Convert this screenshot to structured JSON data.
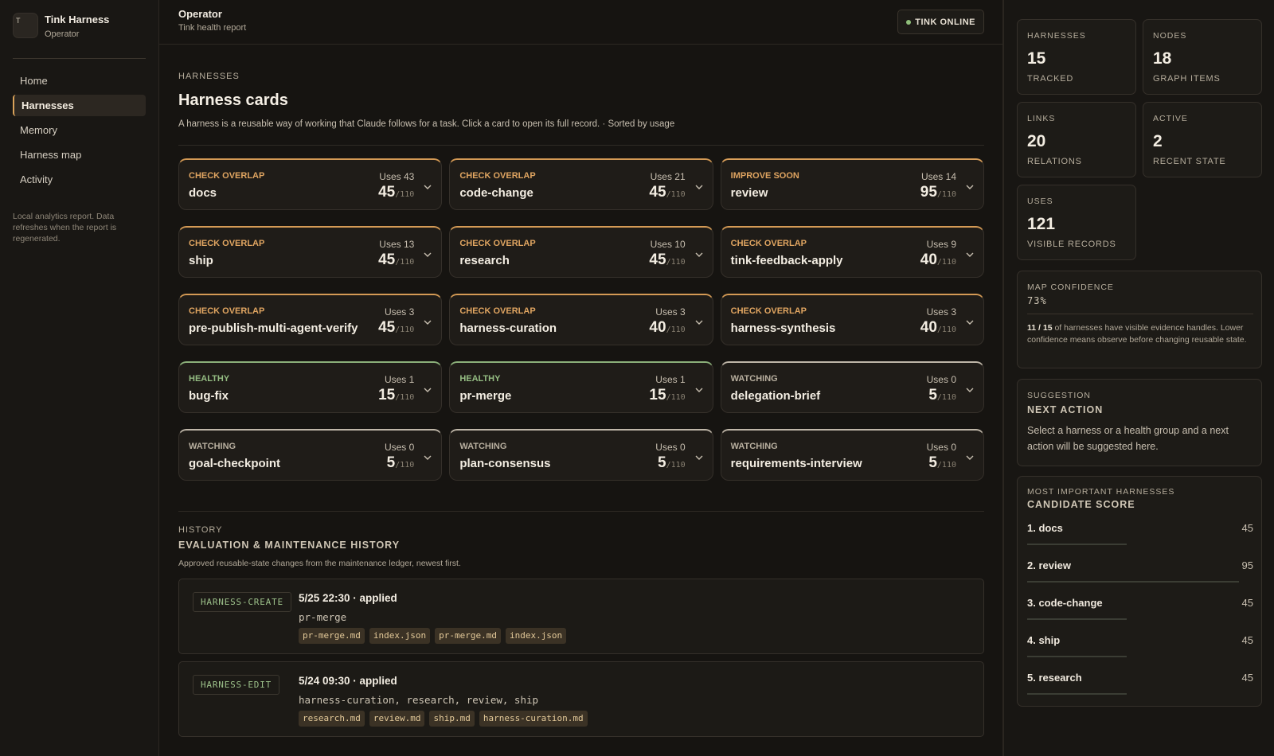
{
  "brand": {
    "logo_letter": "T",
    "title": "Tink Harness",
    "subtitle": "Operator"
  },
  "nav": [
    {
      "label": "Home",
      "active": false
    },
    {
      "label": "Harnesses",
      "active": true
    },
    {
      "label": "Memory",
      "active": false
    },
    {
      "label": "Harness map",
      "active": false
    },
    {
      "label": "Activity",
      "active": false
    }
  ],
  "sidebar_note": "Local analytics report. Data refreshes when the report is regenerated.",
  "topbar": {
    "title": "Operator",
    "subtitle": "Tink health report",
    "status": "TINK ONLINE"
  },
  "section": {
    "eyebrow": "HARNESSES",
    "title": "Harness cards",
    "description": "A harness is a reusable way of working that Claude follows for a task. Click a card to open its full record. · Sorted by usage"
  },
  "cards": [
    {
      "status": "CHECK OVERLAP",
      "kind": "check",
      "name": "docs",
      "uses": "Uses 43",
      "score": "45",
      "max": "/110"
    },
    {
      "status": "CHECK OVERLAP",
      "kind": "check",
      "name": "code-change",
      "uses": "Uses 21",
      "score": "45",
      "max": "/110"
    },
    {
      "status": "IMPROVE SOON",
      "kind": "improve",
      "name": "review",
      "uses": "Uses 14",
      "score": "95",
      "max": "/110"
    },
    {
      "status": "CHECK OVERLAP",
      "kind": "check",
      "name": "ship",
      "uses": "Uses 13",
      "score": "45",
      "max": "/110"
    },
    {
      "status": "CHECK OVERLAP",
      "kind": "check",
      "name": "research",
      "uses": "Uses 10",
      "score": "45",
      "max": "/110"
    },
    {
      "status": "CHECK OVERLAP",
      "kind": "check",
      "name": "tink-feedback-apply",
      "uses": "Uses 9",
      "score": "40",
      "max": "/110"
    },
    {
      "status": "CHECK OVERLAP",
      "kind": "check",
      "name": "pre-publish-multi-agent-verify",
      "uses": "Uses 3",
      "score": "45",
      "max": "/110"
    },
    {
      "status": "CHECK OVERLAP",
      "kind": "check",
      "name": "harness-curation",
      "uses": "Uses 3",
      "score": "40",
      "max": "/110"
    },
    {
      "status": "CHECK OVERLAP",
      "kind": "check",
      "name": "harness-synthesis",
      "uses": "Uses 3",
      "score": "40",
      "max": "/110"
    },
    {
      "status": "HEALTHY",
      "kind": "healthy",
      "name": "bug-fix",
      "uses": "Uses 1",
      "score": "15",
      "max": "/110"
    },
    {
      "status": "HEALTHY",
      "kind": "healthy",
      "name": "pr-merge",
      "uses": "Uses 1",
      "score": "15",
      "max": "/110"
    },
    {
      "status": "WATCHING",
      "kind": "watch",
      "name": "delegation-brief",
      "uses": "Uses 0",
      "score": "5",
      "max": "/110"
    },
    {
      "status": "WATCHING",
      "kind": "watch",
      "name": "goal-checkpoint",
      "uses": "Uses 0",
      "score": "5",
      "max": "/110"
    },
    {
      "status": "WATCHING",
      "kind": "watch",
      "name": "plan-consensus",
      "uses": "Uses 0",
      "score": "5",
      "max": "/110"
    },
    {
      "status": "WATCHING",
      "kind": "watch",
      "name": "requirements-interview",
      "uses": "Uses 0",
      "score": "5",
      "max": "/110"
    }
  ],
  "history": {
    "eyebrow": "HISTORY",
    "title": "EVALUATION & MAINTENANCE HISTORY",
    "description": "Approved reusable-state changes from the maintenance ledger, newest first.",
    "entries": [
      {
        "tag": "HARNESS-CREATE",
        "head": "5/25 22:30 · applied",
        "targets": "pr-merge",
        "files": [
          "pr-merge.md",
          "index.json",
          "pr-merge.md",
          "index.json"
        ]
      },
      {
        "tag": "HARNESS-EDIT",
        "head": "5/24 09:30 · applied",
        "targets": "harness-curation, research, review, ship",
        "files": [
          "research.md",
          "review.md",
          "ship.md",
          "harness-curation.md"
        ]
      }
    ]
  },
  "stats": [
    {
      "label": "HARNESSES",
      "value": "15",
      "sub": "TRACKED"
    },
    {
      "label": "NODES",
      "value": "18",
      "sub": "GRAPH ITEMS"
    },
    {
      "label": "LINKS",
      "value": "20",
      "sub": "RELATIONS"
    },
    {
      "label": "ACTIVE",
      "value": "2",
      "sub": "RECENT STATE"
    },
    {
      "label": "USES",
      "value": "121",
      "sub": "VISIBLE RECORDS"
    }
  ],
  "confidence": {
    "label": "MAP CONFIDENCE",
    "value": "73%",
    "count": "11 / 15",
    "note": " of harnesses have visible evidence handles. Lower confidence means observe before changing reusable state."
  },
  "suggestion": {
    "eyebrow": "SUGGESTION",
    "title": "NEXT ACTION",
    "text": "Select a harness or a health group and a next action will be suggested here."
  },
  "important": {
    "eyebrow": "MOST IMPORTANT HARNESSES",
    "title": "CANDIDATE SCORE",
    "items": [
      {
        "name": "1. docs",
        "score": "45",
        "fraction": 0.47
      },
      {
        "name": "2. review",
        "score": "95",
        "fraction": 1.0
      },
      {
        "name": "3. code-change",
        "score": "45",
        "fraction": 0.47
      },
      {
        "name": "4. ship",
        "score": "45",
        "fraction": 0.47
      },
      {
        "name": "5. research",
        "score": "45",
        "fraction": 0.47
      }
    ]
  }
}
